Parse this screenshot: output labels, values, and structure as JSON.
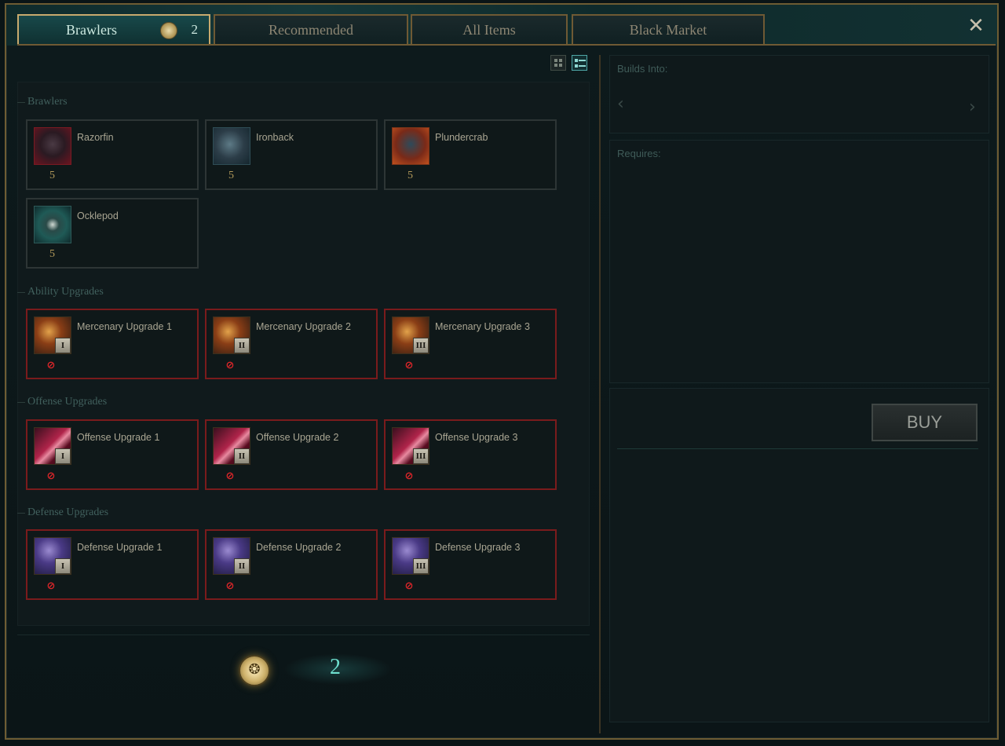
{
  "tabs": [
    {
      "label": "Brawlers",
      "count": "2"
    },
    {
      "label": "Recommended"
    },
    {
      "label": "All Items"
    },
    {
      "label": "Black Market"
    }
  ],
  "close_icon": "✕",
  "sections": {
    "brawlers": {
      "title": "Brawlers",
      "items": [
        {
          "name": "Razorfin",
          "cost": "5"
        },
        {
          "name": "Ironback",
          "cost": "5"
        },
        {
          "name": "Plundercrab",
          "cost": "5"
        },
        {
          "name": "Ocklepod",
          "cost": "5"
        }
      ]
    },
    "ability": {
      "title": "Ability Upgrades",
      "items": [
        {
          "name": "Mercenary Upgrade 1",
          "rank": "I"
        },
        {
          "name": "Mercenary Upgrade 2",
          "rank": "II"
        },
        {
          "name": "Mercenary Upgrade 3",
          "rank": "III"
        }
      ]
    },
    "offense": {
      "title": "Offense Upgrades",
      "items": [
        {
          "name": "Offense Upgrade 1",
          "rank": "I"
        },
        {
          "name": "Offense Upgrade 2",
          "rank": "II"
        },
        {
          "name": "Offense Upgrade 3",
          "rank": "III"
        }
      ]
    },
    "defense": {
      "title": "Defense Upgrades",
      "items": [
        {
          "name": "Defense Upgrade 1",
          "rank": "I"
        },
        {
          "name": "Defense Upgrade 2",
          "rank": "II"
        },
        {
          "name": "Defense Upgrade 3",
          "rank": "III"
        }
      ]
    }
  },
  "gold": {
    "amount": "2",
    "icon": "coin-icon"
  },
  "right": {
    "builds_into_label": "Builds Into:",
    "requires_label": "Requires:",
    "buy_label": "BUY"
  },
  "colors": {
    "accent_gold": "#c8aa6e",
    "accent_teal": "#6fe0cf",
    "locked_red": "#7a1b1c"
  }
}
